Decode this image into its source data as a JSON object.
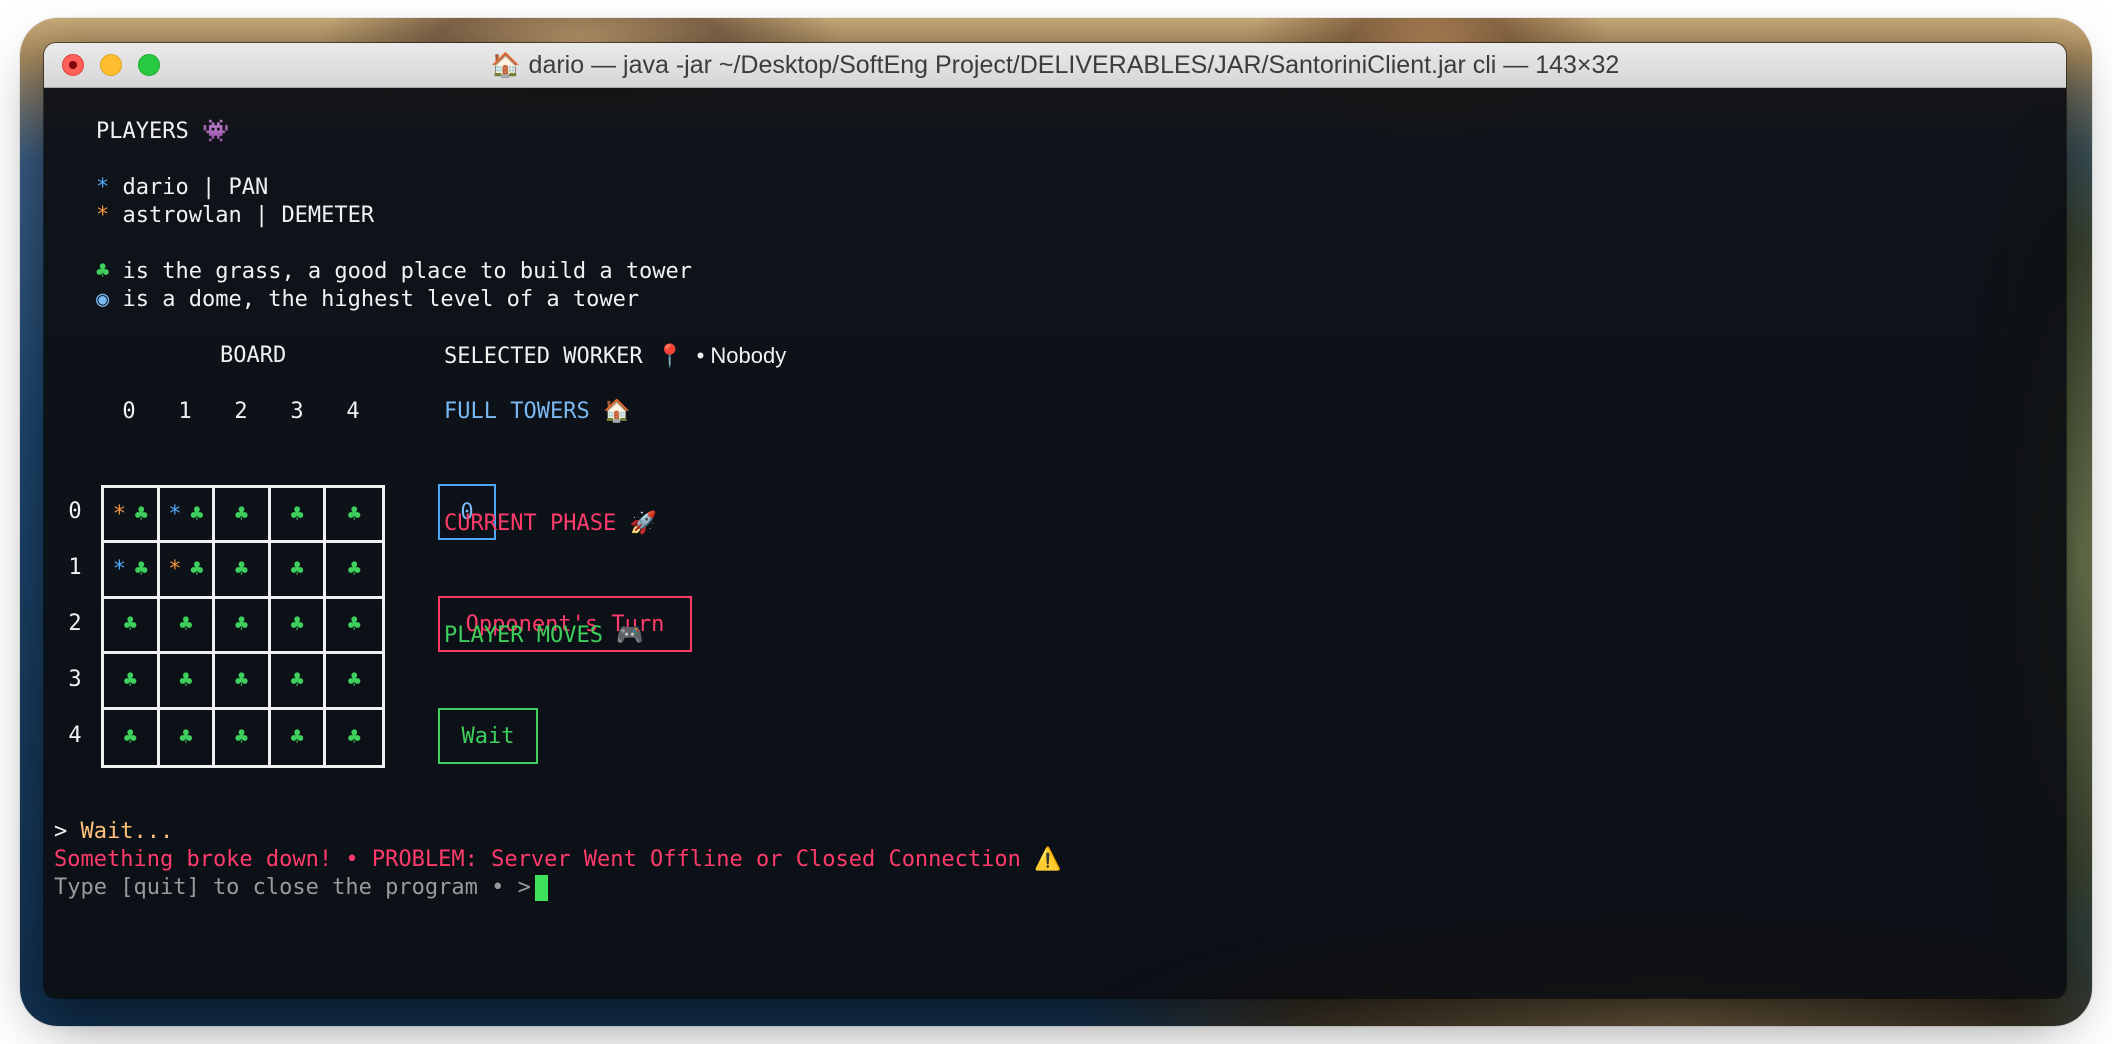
{
  "window": {
    "title": "dario — java -jar ~/Desktop/SoftEng Project/DELIVERABLES/JAR/SantoriniClient.jar cli — 143×32",
    "title_icon": "house-icon"
  },
  "players": {
    "heading": "PLAYERS",
    "heading_icon": "👾",
    "list": [
      {
        "marker": "*",
        "text": "dario | PAN",
        "color": "#4fa6f5"
      },
      {
        "marker": "*",
        "text": "astrowlan | DEMETER",
        "color": "#f0913a"
      }
    ]
  },
  "legend": {
    "grass_symbol": "♣",
    "grass_text": "is the grass, a good place to build a tower",
    "dome_symbol": "◉",
    "dome_text": "is a dome, the highest level of a tower"
  },
  "board": {
    "label": "BOARD",
    "columns": [
      "0",
      "1",
      "2",
      "3",
      "4"
    ],
    "rows": [
      "0",
      "1",
      "2",
      "3",
      "4"
    ],
    "cells": [
      [
        [
          "*o",
          "♣"
        ],
        [
          "*b",
          "♣"
        ],
        [
          "♣"
        ],
        [
          "♣"
        ],
        [
          "♣"
        ]
      ],
      [
        [
          "*b",
          "♣"
        ],
        [
          "*o",
          "♣"
        ],
        [
          "♣"
        ],
        [
          "♣"
        ],
        [
          "♣"
        ]
      ],
      [
        [
          "♣"
        ],
        [
          "♣"
        ],
        [
          "♣"
        ],
        [
          "♣"
        ],
        [
          "♣"
        ]
      ],
      [
        [
          "♣"
        ],
        [
          "♣"
        ],
        [
          "♣"
        ],
        [
          "♣"
        ],
        [
          "♣"
        ]
      ],
      [
        [
          "♣"
        ],
        [
          "♣"
        ],
        [
          "♣"
        ],
        [
          "♣"
        ],
        [
          "♣"
        ]
      ]
    ]
  },
  "status": {
    "selected_worker_label": "SELECTED WORKER",
    "selected_worker_icon": "📍",
    "selected_worker_value": "• Nobody",
    "full_towers_label": "FULL TOWERS",
    "full_towers_icon": "🏠",
    "full_towers_value": "0",
    "current_phase_label": "CURRENT PHASE",
    "current_phase_icon": "🚀",
    "current_phase_value": "Opponent's Turn",
    "player_moves_label": "PLAYER MOVES",
    "player_moves_icon": "🎮",
    "player_moves_value": "Wait"
  },
  "console": {
    "prompt_marker": ">",
    "wait_text": "Wait...",
    "error_text": "Something broke down! • PROBLEM: Server Went Offline or Closed Connection",
    "error_icon": "⚠️",
    "quit_text": "Type [quit] to close the program • >"
  },
  "colors": {
    "player_blue": "#4fa6f5",
    "player_orange": "#f0913a",
    "grass_green": "#3fcf5c",
    "phase_red": "#ff3b6b",
    "towers_blue": "#7ab8f2"
  }
}
